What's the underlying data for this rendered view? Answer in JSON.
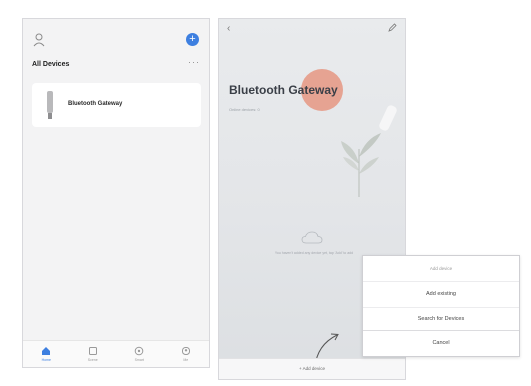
{
  "home": {
    "section_title": "All Devices",
    "more_label": "···",
    "add_label": "+",
    "devices": [
      {
        "name": "Bluetooth Gateway"
      }
    ],
    "tabs": [
      {
        "label": "Home",
        "icon": "home-icon",
        "active": true
      },
      {
        "label": "Scene",
        "icon": "scene-icon",
        "active": false
      },
      {
        "label": "Smart",
        "icon": "smart-icon",
        "active": false
      },
      {
        "label": "Me",
        "icon": "me-icon",
        "active": false
      }
    ]
  },
  "gateway": {
    "title": "Bluetooth Gateway",
    "subtitle": "Online devices: 0",
    "back_label": "‹",
    "empty_text": "You haven't added any device yet, tap 'Add' to add",
    "add_device_label": "+ Add device"
  },
  "action_sheet": {
    "title": "Add device",
    "options": [
      "Add existing",
      "Search for Devices"
    ],
    "cancel_label": "Cancel"
  },
  "colors": {
    "accent": "#3d7fe0",
    "touch_highlight": "#e59682"
  }
}
